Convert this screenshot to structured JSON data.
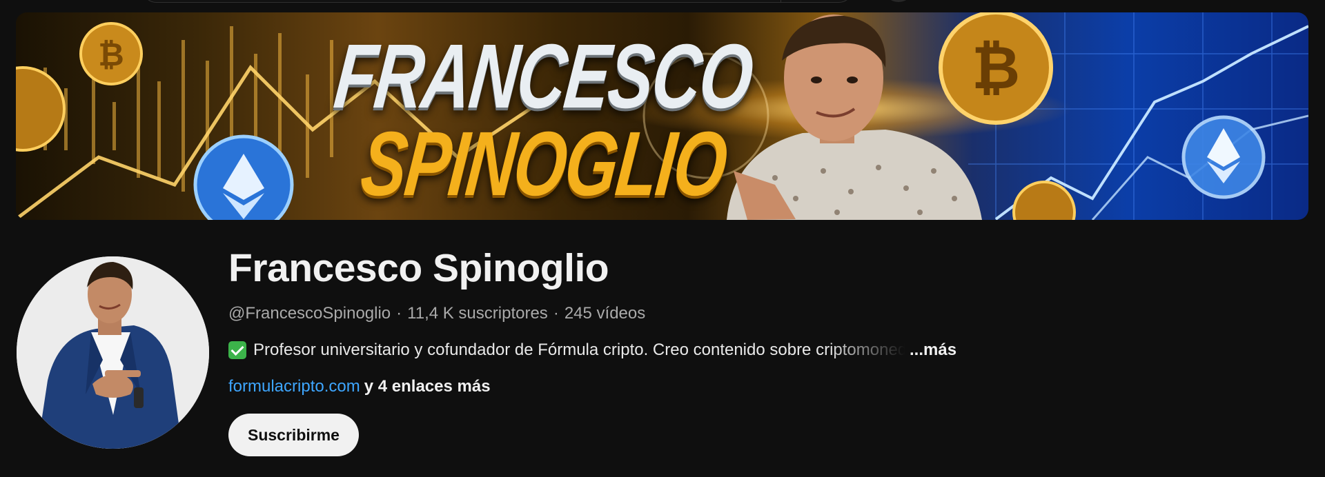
{
  "banner": {
    "title_line1": "FRANCESCO",
    "title_line2": "SPINOGLIO"
  },
  "channel": {
    "name": "Francesco Spinoglio",
    "handle": "@FrancescoSpinoglio",
    "subscribers": "11,4 K suscriptores",
    "videos": "245 vídeos",
    "separator": "·",
    "description_icon": "check-mark-icon",
    "description": "Profesor universitario y cofundador de Fórmula cripto. Creo contenido sobre criptomonedas",
    "more_label": "...más",
    "link": "formulacripto.com",
    "more_links": "y 4 enlaces más",
    "subscribe_label": "Suscribirme"
  },
  "colors": {
    "background": "#0f0f0f",
    "link": "#3ea6ff",
    "secondary_text": "#aaaaaa",
    "subscribe_bg": "#f1f1f1",
    "check_green": "#3cb34a"
  }
}
